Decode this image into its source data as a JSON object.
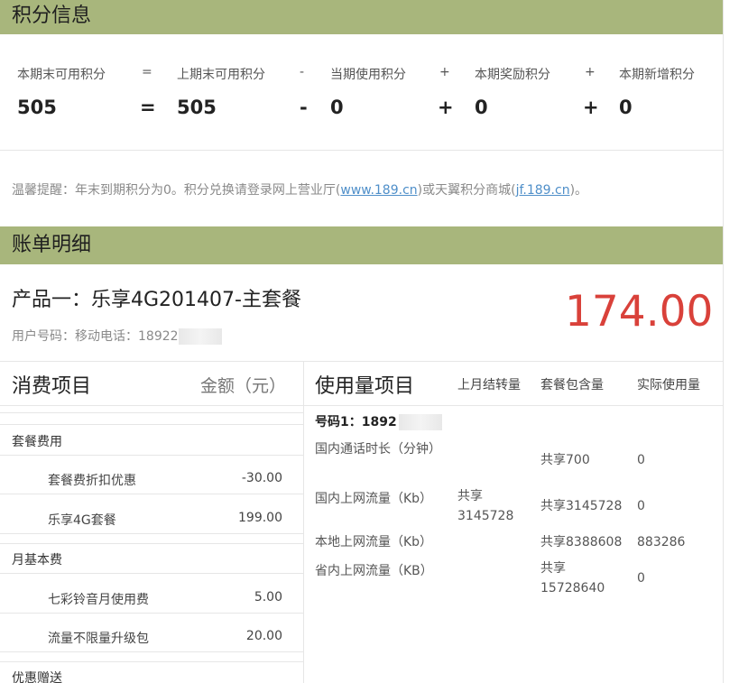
{
  "points": {
    "header": "积分信息",
    "labels": [
      "本期末可用积分",
      "=",
      "上期末可用积分",
      "-",
      "当期使用积分",
      "+",
      "本期奖励积分",
      "+",
      "本期新增积分"
    ],
    "values": [
      "505",
      "=",
      "505",
      "-",
      "0",
      "+",
      "0",
      "+",
      "0"
    ],
    "tip_prefix": "温馨提醒：年末到期积分为0。积分兑换请登录网上营业厅(",
    "tip_link1": "www.189.cn",
    "tip_middle": ")或天翼积分商城(",
    "tip_link2": "jf.189.cn",
    "tip_suffix": ")。"
  },
  "bill": {
    "header": "账单明细",
    "product_title": "产品一：乐享4G201407-主套餐",
    "product_phone": "用户号码：移动电话：18922",
    "product_amount": "174.00"
  },
  "fees": {
    "col_item": "消费项目",
    "col_amount": "金额（元）",
    "groups": [
      {
        "name": "套餐费用",
        "items": [
          {
            "name": "套餐费折扣优惠",
            "amount": "-30.00"
          },
          {
            "name": "乐享4G套餐",
            "amount": "199.00"
          }
        ]
      },
      {
        "name": "月基本费",
        "items": [
          {
            "name": "七彩铃音月使用费",
            "amount": "5.00"
          },
          {
            "name": "流量不限量升级包",
            "amount": "20.00"
          }
        ]
      },
      {
        "name": "优惠赠送",
        "items": []
      }
    ]
  },
  "usage": {
    "col_item": "使用量项目",
    "col_last": "上月结转量",
    "col_package": "套餐包含量",
    "col_actual": "实际使用量",
    "number_label": "号码1：1892",
    "rows": [
      {
        "item": "国内通话时长（分钟）",
        "last": "",
        "package": "共享700",
        "actual": "0"
      },
      {
        "item": "国内上网流量（Kb）",
        "last": "共享3145728",
        "package": "共享3145728",
        "actual": "0"
      },
      {
        "item": "本地上网流量（Kb）",
        "last": "",
        "package": "共享8388608",
        "actual": "883286"
      },
      {
        "item": "省内上网流量（KB）",
        "last": "",
        "package": "共享15728640",
        "actual": "0"
      }
    ]
  }
}
